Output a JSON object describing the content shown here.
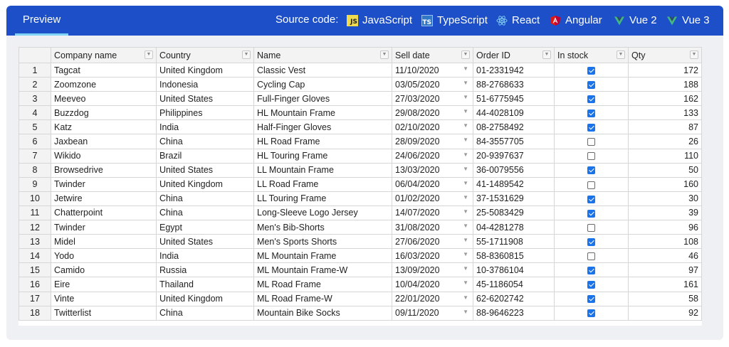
{
  "header": {
    "preview_tab": "Preview",
    "source_label": "Source code:",
    "frameworks": [
      {
        "label": "JavaScript",
        "icon": "javascript-icon",
        "glyph": "JS"
      },
      {
        "label": "TypeScript",
        "icon": "typescript-icon",
        "glyph": "TS"
      },
      {
        "label": "React",
        "icon": "react-icon"
      },
      {
        "label": "Angular",
        "icon": "angular-icon"
      },
      {
        "label": "Vue 2",
        "icon": "vue-icon"
      },
      {
        "label": "Vue 3",
        "icon": "vue-icon"
      }
    ]
  },
  "colors": {
    "topbar": "#1c4fc8",
    "tab_underline": "#7fd3f5",
    "checkbox_checked": "#1a73e8",
    "react_icon": "#7ec8f0",
    "angular_icon": "#dd1b16",
    "vue_icon": "#41b883"
  },
  "grid": {
    "columns": [
      "Company name",
      "Country",
      "Name",
      "Sell date",
      "Order ID",
      "In stock",
      "Qty"
    ],
    "rows": [
      {
        "n": "1",
        "company": "Tagcat",
        "country": "United Kingdom",
        "name": "Classic Vest",
        "date": "11/10/2020",
        "order": "01-2331942",
        "stock": true,
        "qty": "172"
      },
      {
        "n": "2",
        "company": "Zoomzone",
        "country": "Indonesia",
        "name": "Cycling Cap",
        "date": "03/05/2020",
        "order": "88-2768633",
        "stock": true,
        "qty": "188"
      },
      {
        "n": "3",
        "company": "Meeveo",
        "country": "United States",
        "name": "Full-Finger Gloves",
        "date": "27/03/2020",
        "order": "51-6775945",
        "stock": true,
        "qty": "162"
      },
      {
        "n": "4",
        "company": "Buzzdog",
        "country": "Philippines",
        "name": "HL Mountain Frame",
        "date": "29/08/2020",
        "order": "44-4028109",
        "stock": true,
        "qty": "133"
      },
      {
        "n": "5",
        "company": "Katz",
        "country": "India",
        "name": "Half-Finger Gloves",
        "date": "02/10/2020",
        "order": "08-2758492",
        "stock": true,
        "qty": "87"
      },
      {
        "n": "6",
        "company": "Jaxbean",
        "country": "China",
        "name": "HL Road Frame",
        "date": "28/09/2020",
        "order": "84-3557705",
        "stock": false,
        "qty": "26"
      },
      {
        "n": "7",
        "company": "Wikido",
        "country": "Brazil",
        "name": "HL Touring Frame",
        "date": "24/06/2020",
        "order": "20-9397637",
        "stock": false,
        "qty": "110"
      },
      {
        "n": "8",
        "company": "Browsedrive",
        "country": "United States",
        "name": "LL Mountain Frame",
        "date": "13/03/2020",
        "order": "36-0079556",
        "stock": true,
        "qty": "50"
      },
      {
        "n": "9",
        "company": "Twinder",
        "country": "United Kingdom",
        "name": "LL Road Frame",
        "date": "06/04/2020",
        "order": "41-1489542",
        "stock": false,
        "qty": "160"
      },
      {
        "n": "10",
        "company": "Jetwire",
        "country": "China",
        "name": "LL Touring Frame",
        "date": "01/02/2020",
        "order": "37-1531629",
        "stock": true,
        "qty": "30"
      },
      {
        "n": "11",
        "company": "Chatterpoint",
        "country": "China",
        "name": "Long-Sleeve Logo Jersey",
        "date": "14/07/2020",
        "order": "25-5083429",
        "stock": true,
        "qty": "39"
      },
      {
        "n": "12",
        "company": "Twinder",
        "country": "Egypt",
        "name": "Men's Bib-Shorts",
        "date": "31/08/2020",
        "order": "04-4281278",
        "stock": false,
        "qty": "96"
      },
      {
        "n": "13",
        "company": "Midel",
        "country": "United States",
        "name": "Men's Sports Shorts",
        "date": "27/06/2020",
        "order": "55-1711908",
        "stock": true,
        "qty": "108"
      },
      {
        "n": "14",
        "company": "Yodo",
        "country": "India",
        "name": "ML Mountain Frame",
        "date": "16/03/2020",
        "order": "58-8360815",
        "stock": false,
        "qty": "46"
      },
      {
        "n": "15",
        "company": "Camido",
        "country": "Russia",
        "name": "ML Mountain Frame-W",
        "date": "13/09/2020",
        "order": "10-3786104",
        "stock": true,
        "qty": "97"
      },
      {
        "n": "16",
        "company": "Eire",
        "country": "Thailand",
        "name": "ML Road Frame",
        "date": "10/04/2020",
        "order": "45-1186054",
        "stock": true,
        "qty": "161"
      },
      {
        "n": "17",
        "company": "Vinte",
        "country": "United Kingdom",
        "name": "ML Road Frame-W",
        "date": "22/01/2020",
        "order": "62-6202742",
        "stock": true,
        "qty": "58"
      },
      {
        "n": "18",
        "company": "Twitterlist",
        "country": "China",
        "name": "Mountain Bike Socks",
        "date": "09/11/2020",
        "order": "88-9646223",
        "stock": true,
        "qty": "92"
      }
    ]
  }
}
